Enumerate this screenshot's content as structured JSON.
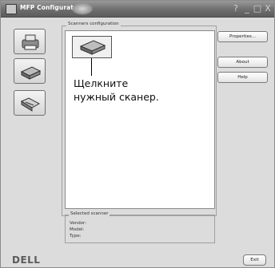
{
  "window": {
    "title": "MFP Configurator",
    "controls": [
      "?",
      "_",
      "□",
      "X"
    ]
  },
  "toolbar": {
    "items": [
      {
        "icon": "printer-icon"
      },
      {
        "icon": "scanner-icon"
      },
      {
        "icon": "port-icon"
      }
    ]
  },
  "scanners": {
    "group_label": "Scanners configuration",
    "items": [
      {
        "icon": "scanner-icon"
      }
    ],
    "callout": [
      "Щелкните",
      "нужный сканер."
    ]
  },
  "selected_scanner": {
    "label": "Selected scanner",
    "vendor_label": "Vendor:",
    "model_label": "Model:",
    "type_label": "Type:"
  },
  "buttons": {
    "properties": "Properties...",
    "about": "About",
    "help": "Help",
    "exit": "Exit"
  },
  "brand": {
    "logo": "DELL"
  }
}
